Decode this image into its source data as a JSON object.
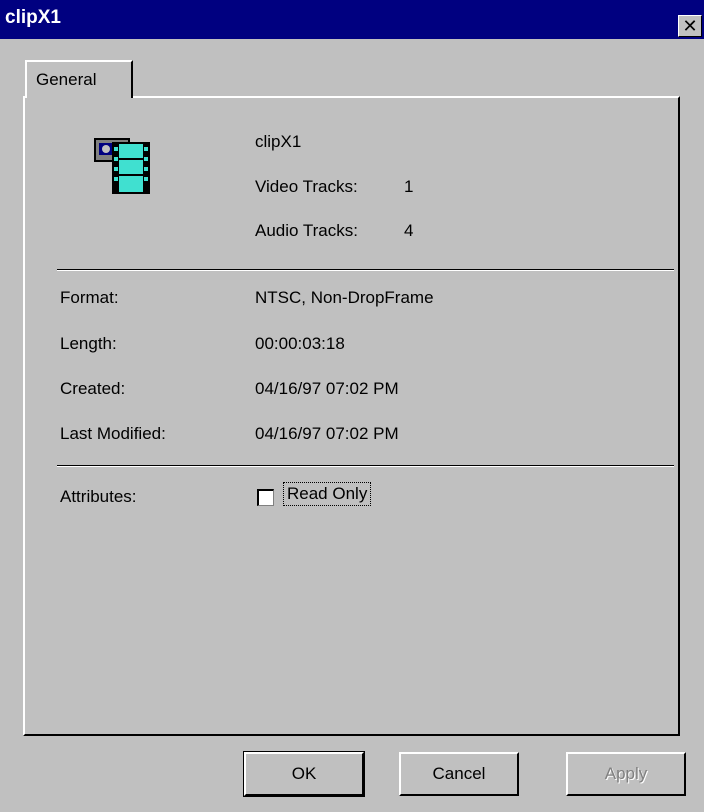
{
  "window": {
    "title": "clipX1",
    "close_glyph": "✕"
  },
  "tabs": [
    {
      "label": "General",
      "active": true
    }
  ],
  "clip": {
    "icon": "film-clip-icon",
    "name": "clipX1",
    "video_tracks_label": "Video Tracks:",
    "video_tracks_value": "1",
    "audio_tracks_label": "Audio Tracks:",
    "audio_tracks_value": "4"
  },
  "properties": [
    {
      "label": "Format:",
      "value": "NTSC, Non-DropFrame"
    },
    {
      "label": "Length:",
      "value": "00:00:03:18"
    },
    {
      "label": "Created:",
      "value": "04/16/97 07:02 PM"
    },
    {
      "label": "Last Modified:",
      "value": "04/16/97 07:02 PM"
    }
  ],
  "attributes": {
    "label": "Attributes:",
    "read_only_label": "Read Only",
    "read_only_checked": false
  },
  "buttons": {
    "ok": "OK",
    "cancel": "Cancel",
    "apply": "Apply",
    "apply_enabled": false
  },
  "colors": {
    "titlebar": "#000080",
    "face": "#c0c0c0",
    "icon_film": "#40e0d0"
  }
}
